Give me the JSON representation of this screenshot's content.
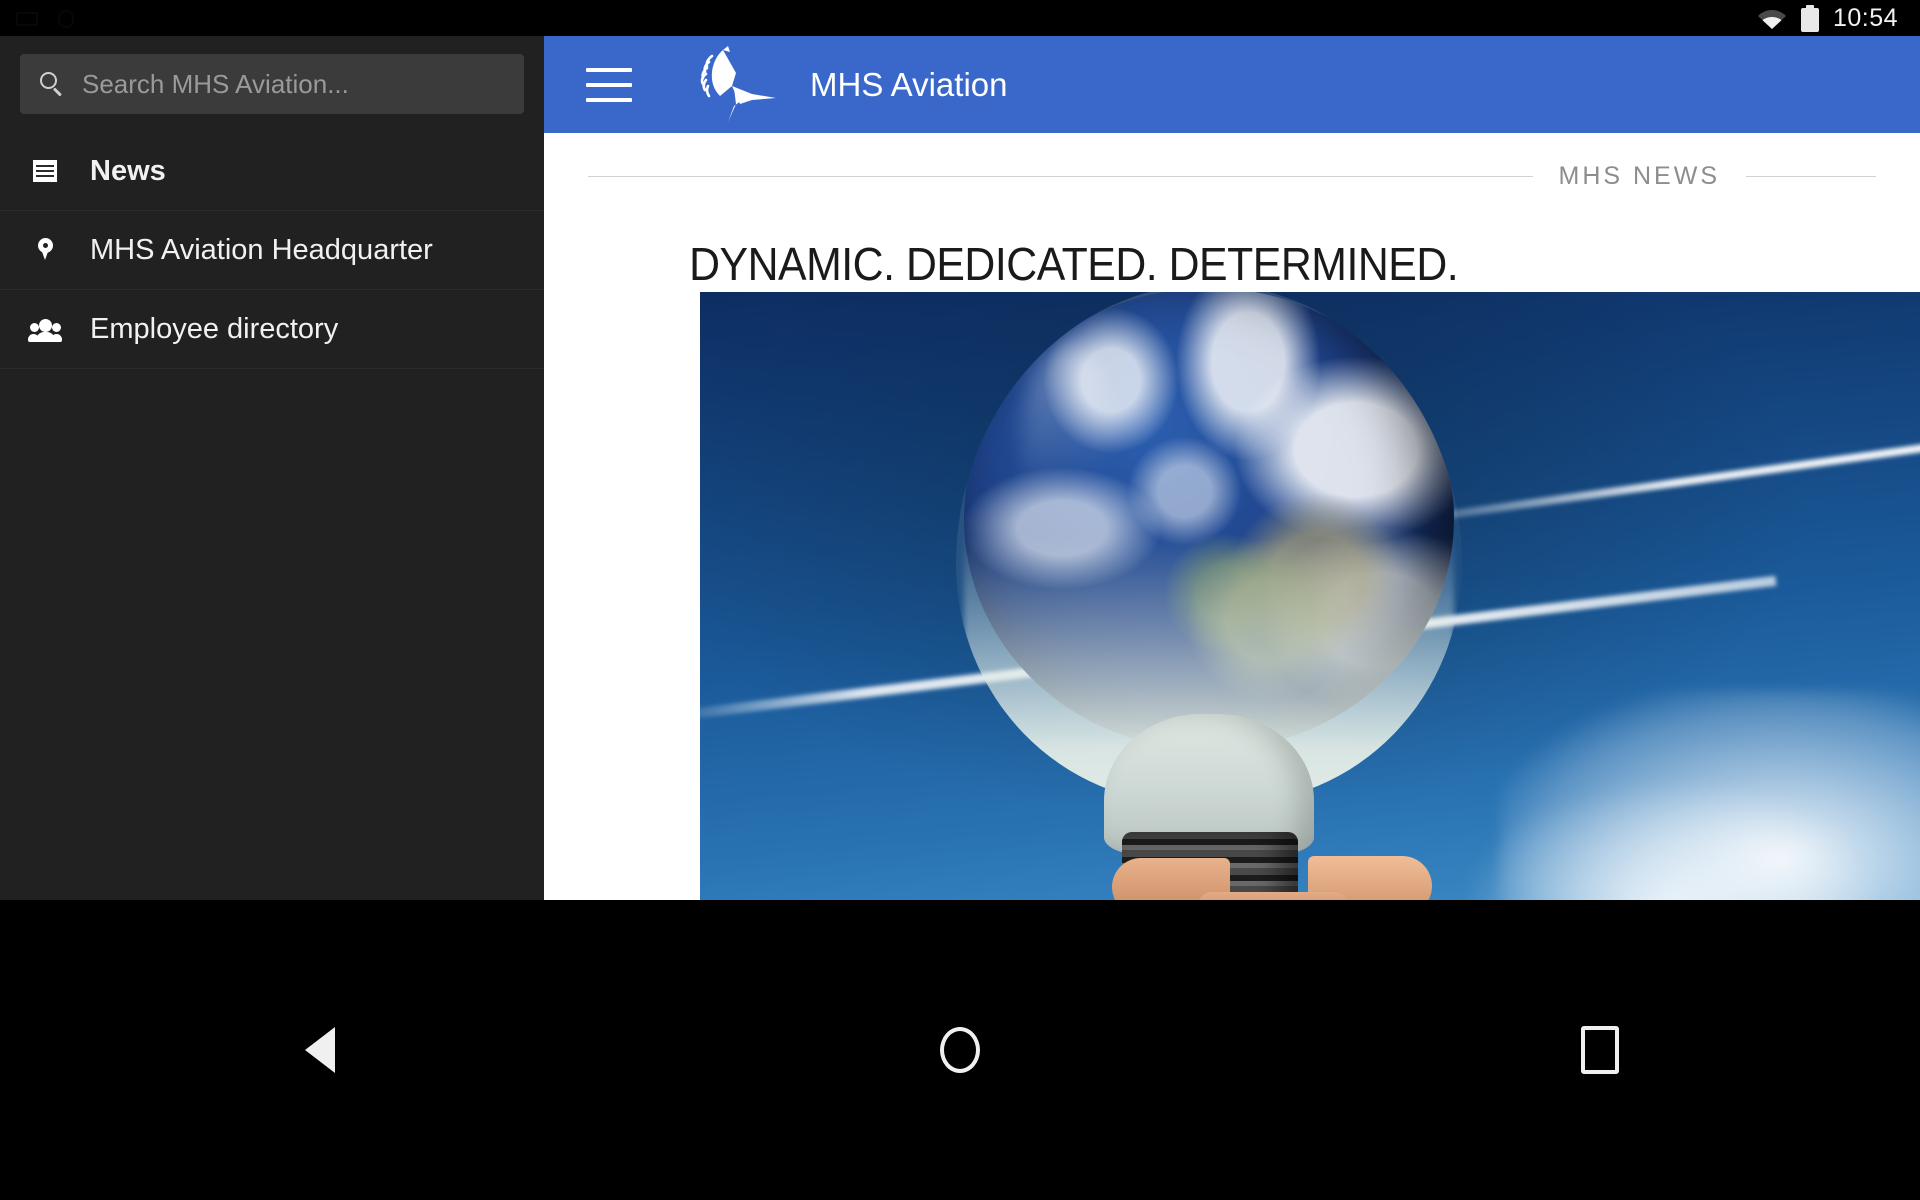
{
  "statusbar": {
    "time": "10:54",
    "wifi_icon": "wifi-icon",
    "battery_icon": "battery-full-icon"
  },
  "sidebar": {
    "search": {
      "placeholder": "Search MHS Aviation...",
      "value": "",
      "icon": "search-icon"
    },
    "items": [
      {
        "label": "News",
        "icon": "news-icon",
        "active": true
      },
      {
        "label": "MHS Aviation Headquarter",
        "icon": "location-pin-icon",
        "active": false
      },
      {
        "label": "Employee directory",
        "icon": "people-group-icon",
        "active": false
      }
    ]
  },
  "appbar": {
    "menu_icon": "hamburger-menu-icon",
    "logo_icon": "bird-logo-icon",
    "title": "MHS Aviation",
    "background_color": "#3a68ca"
  },
  "main": {
    "section_label": "MHS NEWS",
    "headline": "DYNAMIC. DEDICATED. DETERMINED.",
    "hero_image_alt": "lightbulb-with-earth-inside-held-by-hand-against-blue-sky-with-airplane-contrail"
  },
  "navbar": {
    "back_label": "Back",
    "home_label": "Home",
    "recents_label": "Recents",
    "back_icon": "triangle-back-icon",
    "home_icon": "circle-home-icon",
    "recents_icon": "square-recents-icon"
  },
  "colors": {
    "accent": "#3a68ca",
    "sidebar_bg": "#212121",
    "search_bg": "#3b3b3b",
    "content_bg": "#ffffff",
    "section_label": "#8d8d8d"
  }
}
